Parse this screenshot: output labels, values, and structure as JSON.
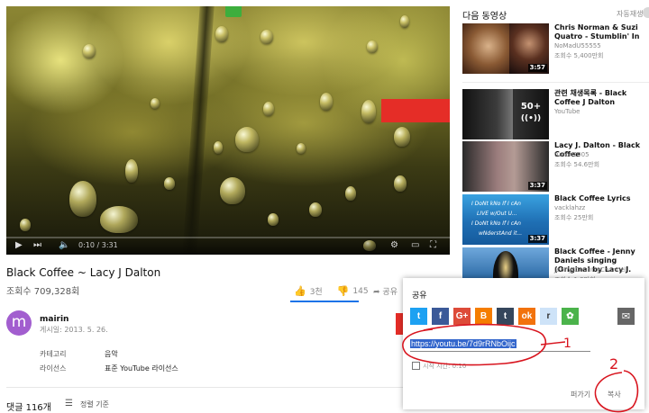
{
  "player": {
    "time": "0:10 / 3:31"
  },
  "video": {
    "title": "Black Coffee ~ Lacy J Dalton",
    "views": "조회수 709,328회",
    "likes": "3천",
    "dislikes": "145",
    "share_label": "공유"
  },
  "channel": {
    "avatar_letter": "m",
    "name": "mairin",
    "published": "게시일: 2013. 5. 26.",
    "category_label": "카테고리",
    "category_value": "음악",
    "license_label": "라이선스",
    "license_value": "표준 YouTube 라이선스"
  },
  "comments": {
    "count": "댓글 116개",
    "sort_label": "정렬 기준"
  },
  "sidebar": {
    "up_next": "다음 동영상",
    "autoplay": "자동재생",
    "items": [
      {
        "title": "Chris Norman & Suzi Quatro - Stumblin' In",
        "channel": "NoMadU55555",
        "views": "조회수 5,400만회",
        "duration": "3:57"
      },
      {
        "title": "관련 채생목록 - Black Coffee J Dalton",
        "channel": "YouTube",
        "badge_count": "50+",
        "badge_icon": "radio-waves-icon"
      },
      {
        "title": "Lacy J. Dalton - Black Coffee",
        "channel": "turion2005",
        "views": "조회수 54.6만회",
        "duration": "3:37"
      },
      {
        "title": "Black Coffee Lyrics",
        "channel": "vacklahzz",
        "views": "조회수 25만회",
        "duration": "3:37",
        "thumb_lines": [
          "I DoNt kNo If I cAn",
          "LIVE w/Out U...",
          "I DoNt kNo If I cAn",
          "wNderstAnd it..."
        ]
      },
      {
        "title": "Black Coffee - Jenny Daniels singing (Original by Lacy J.",
        "channel": "JennysCountryChannel",
        "views": "조회수 1.9만회"
      }
    ]
  },
  "share": {
    "title": "공유",
    "url": "https://youtu.be/7d9rRNbOijc",
    "start_at_label": "시작 시간: 0:10",
    "embed": "퍼가기",
    "copy": "복사",
    "services": [
      {
        "name": "twitter",
        "letter": "t",
        "color": "#1da1f2"
      },
      {
        "name": "facebook",
        "letter": "f",
        "color": "#3b5998"
      },
      {
        "name": "googleplus",
        "letter": "G+",
        "color": "#dd4b39"
      },
      {
        "name": "blogger",
        "letter": "B",
        "color": "#f57d00"
      },
      {
        "name": "tumblr",
        "letter": "t",
        "color": "#35465c"
      },
      {
        "name": "odnoklassniki",
        "letter": "ok",
        "color": "#f2720c"
      },
      {
        "name": "reddit",
        "letter": "r",
        "color": "#cee3f8"
      },
      {
        "name": "vk",
        "letter": "✿",
        "color": "#4bb34b"
      }
    ]
  },
  "annotations": {
    "one": "1",
    "two": "2"
  }
}
